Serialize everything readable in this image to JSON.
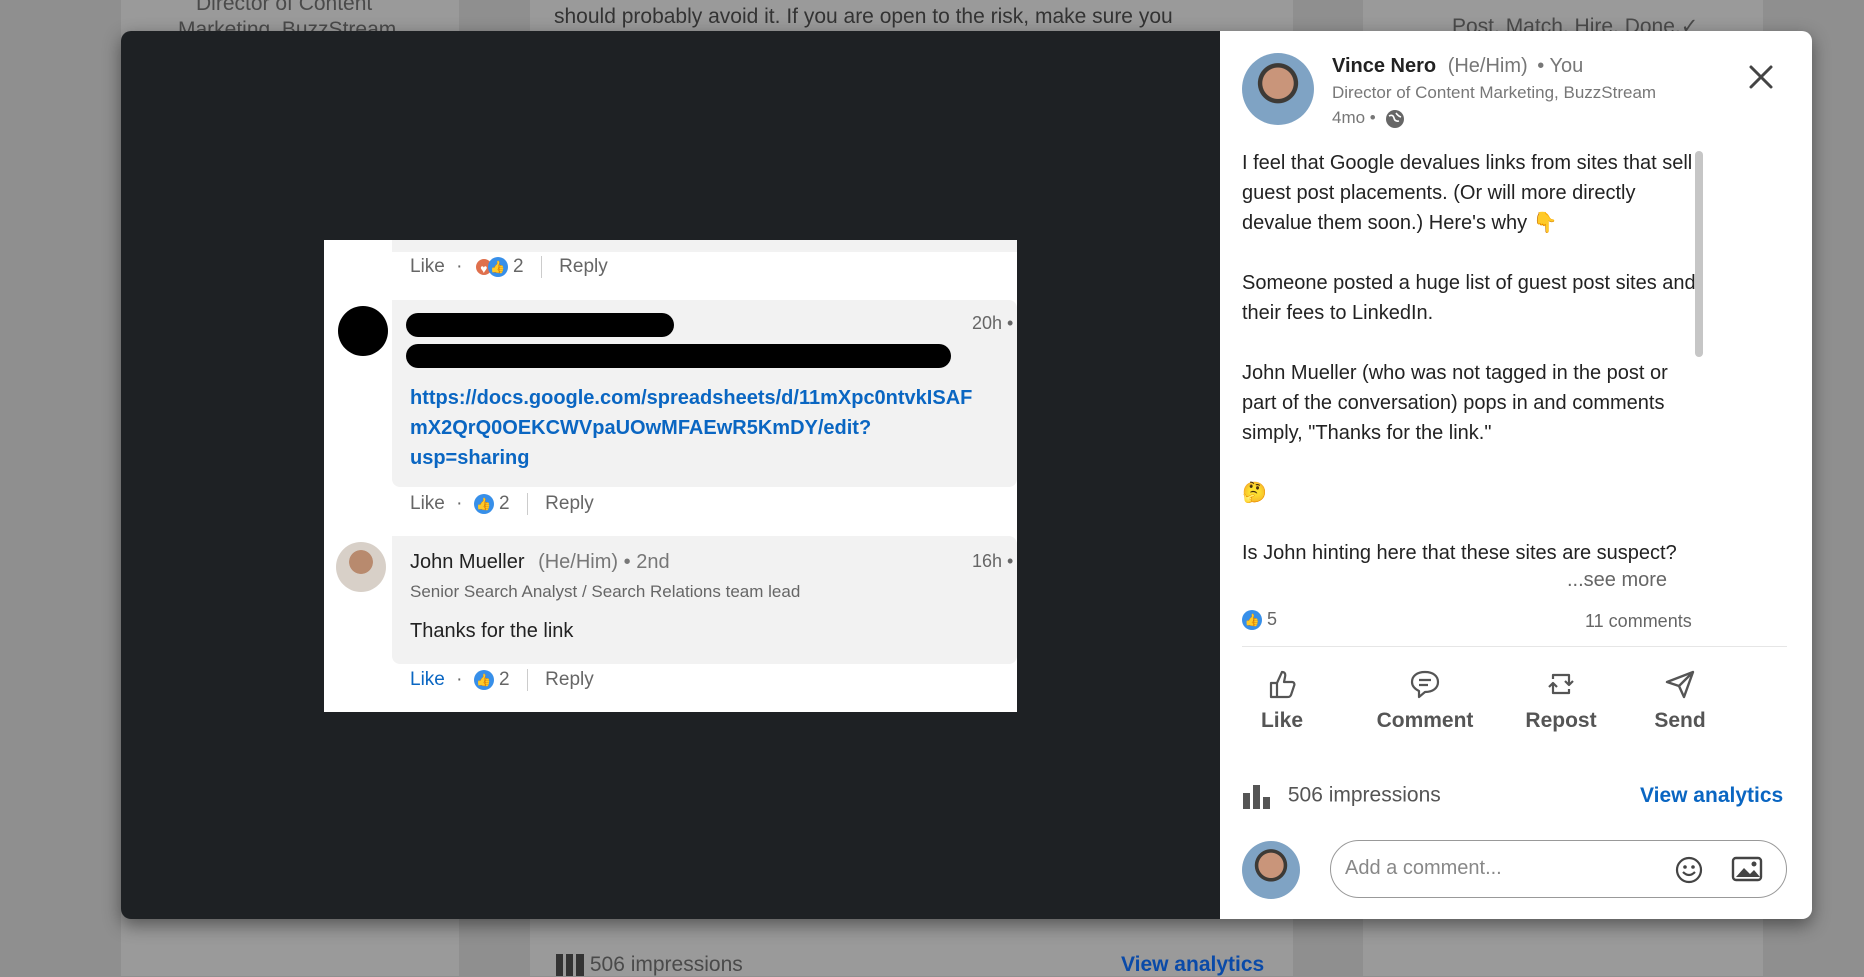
{
  "background": {
    "left_text": "Director of Content",
    "left_text_2": "Marketing, BuzzStream",
    "center_text": "should probably avoid it. If you are open to the risk, make sure you",
    "right_text": "Post. Match. Hire. Done.✓",
    "impressions": "506 impressions",
    "view_analytics": "View analytics"
  },
  "screenshot": {
    "top_row": {
      "like": "Like",
      "count": "2",
      "reply": "Reply"
    },
    "comment1": {
      "time": "20h •",
      "link_line1": "https://docs.google.com/spreadsheets/d/11mXpc0ntvkISAF",
      "link_line2": "mX2QrQ0OEKCWVpaUOwMFAEwR5KmDY/edit?",
      "link_line3": "usp=sharing",
      "like": "Like",
      "count": "2",
      "reply": "Reply"
    },
    "comment2": {
      "name": "John Mueller",
      "pronouns": "(He/Him)",
      "degree": "• 2nd",
      "time": "16h •",
      "headline": "Senior Search Analyst / Search Relations team lead",
      "text": "Thanks for the link",
      "like": "Like",
      "count": "2",
      "reply": "Reply"
    }
  },
  "panel": {
    "author_name": "Vince Nero",
    "author_pronouns": "(He/Him)",
    "author_you": "• You",
    "author_headline": "Director of Content Marketing, BuzzStream",
    "post_age": "4mo •",
    "body": [
      "I feel that Google devalues links from sites that sell",
      "guest post placements. (Or will more directly",
      "devalue them soon.) Here's why 👇",
      "Someone posted a huge list of guest post sites and",
      "their fees to LinkedIn.",
      "John Mueller (who was not tagged in the post or",
      "part of the conversation) pops in and comments",
      "simply, \"Thanks for the link.\"",
      "🤔",
      "Is John hinting here that these sites are suspect?"
    ],
    "see_more": "...see more",
    "reaction_count": "5",
    "comments_count": "11 comments",
    "actions": {
      "like": "Like",
      "comment": "Comment",
      "repost": "Repost",
      "send": "Send"
    },
    "impressions": "506 impressions",
    "view_analytics": "View analytics",
    "comment_placeholder": "Add a comment..."
  },
  "colors": {
    "link": "#0a66c2",
    "reaction": "#378fe9",
    "dark_bg": "#1e2124"
  }
}
